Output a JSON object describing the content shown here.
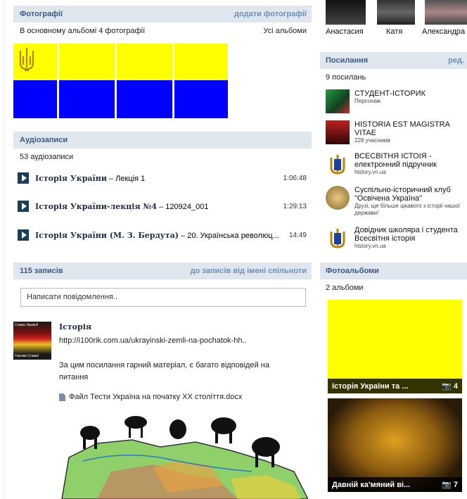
{
  "photos": {
    "title": "Фотографії",
    "add_link": "додати фотографії",
    "count_text": "В основному альбомі 4 фотографії",
    "all_link": "Усі альбоми"
  },
  "audio": {
    "title": "Аудіозаписи",
    "count_text": "53 аудіозаписи",
    "tracks": [
      {
        "artist": "Історія України",
        "title": " – Лекція 1",
        "duration": "1:06:48"
      },
      {
        "artist": "Історія України-лекція №4",
        "title": " – 120924_001",
        "duration": "1:29:13"
      },
      {
        "artist": "Історія України (М. З. Бердута)",
        "title": " – 20. Українська революц...",
        "duration": "14:49"
      }
    ]
  },
  "wall": {
    "count": "115 записів",
    "filter_link": "до записів від імені спільноти",
    "placeholder": "Написати повідомлення..",
    "post": {
      "author": "Історія",
      "url": "http://i100rik.com.ua/ukrayinski-zemli-na-pochatok-hh..",
      "text": "За цим посилання гарний матеріал, є багато відповідей на питання",
      "file": "Файл Тести Україна на початку XX століття.docx",
      "avatar_caption_top": "Слава Україні!",
      "avatar_caption_bottom": "Героям Слава!"
    }
  },
  "friends": [
    "Анастасия",
    "Катя",
    "Александра"
  ],
  "links": {
    "title": "Посилання",
    "edit": "ред.",
    "count_text": "9 посилань",
    "items": [
      {
        "name": "СТУДЕНТ-ІСТОРИК",
        "desc": "Персонаж"
      },
      {
        "name": "HISTORIA EST MAGISTRA VITAE",
        "desc": "228 учасників"
      },
      {
        "name": "ВСЕСВІТНЯ ІСТОІЯ - електронний підручник",
        "desc": "history.vn.ua"
      },
      {
        "name": "Суспільно-історичний клуб \"Освічена Україна\"",
        "desc": "Друзі, ще більше цікавого з історії нашої держави!"
      },
      {
        "name": "Довідник школяра і студента Всесвітня історія",
        "desc": "history.vn.ua"
      }
    ]
  },
  "albums": {
    "title": "Фотоальбоми",
    "count_text": "2 альбоми",
    "items": [
      {
        "name": "Історія України та ...",
        "count": "4"
      },
      {
        "name": "Давній ка'мяний ві...",
        "count": "7"
      }
    ]
  },
  "colors": {
    "flag_yellow": "#ffff00",
    "flag_blue": "#0000ff",
    "header_bg": "#dfe6ee",
    "header_text": "#3a5a80"
  }
}
